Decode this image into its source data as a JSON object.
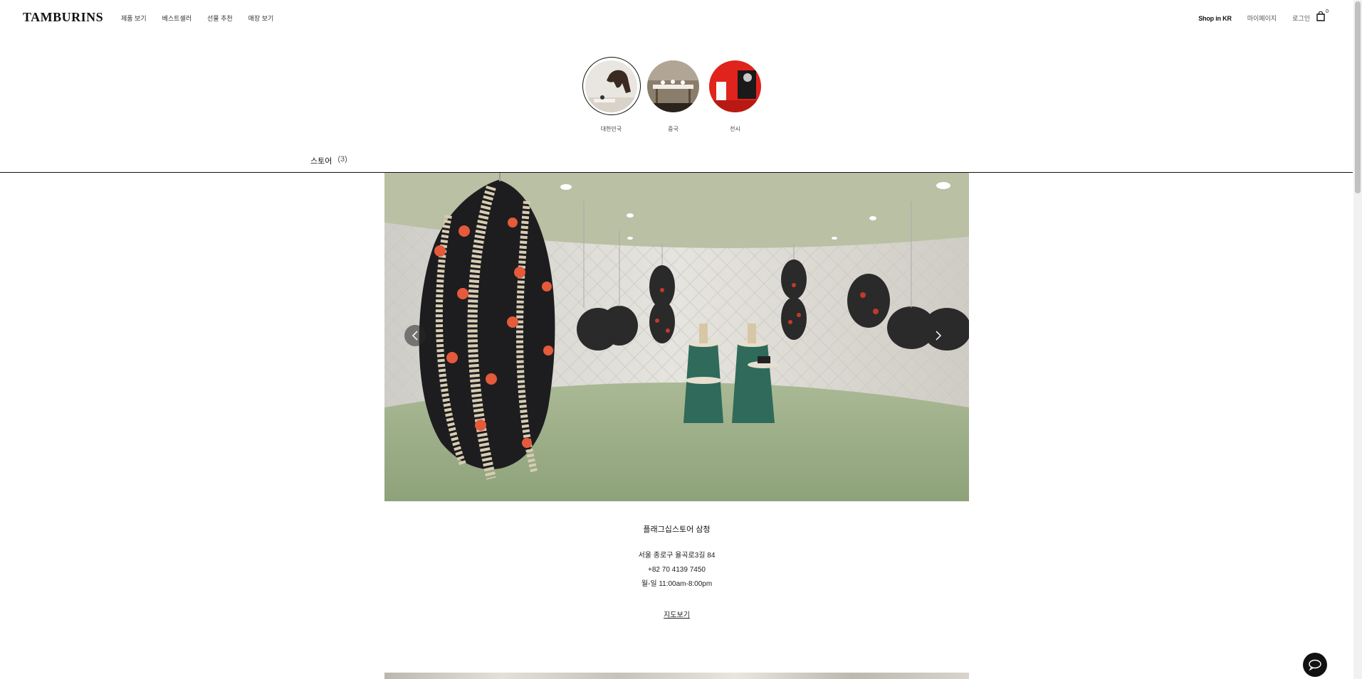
{
  "header": {
    "logo": "TAMBURINS",
    "nav": [
      {
        "label": "제품 보기"
      },
      {
        "label": "베스트셀러"
      },
      {
        "label": "선물 추천"
      },
      {
        "label": "매장 보기"
      }
    ],
    "util": {
      "shop": "Shop in KR",
      "mypage": "마이페이지",
      "login": "로그인",
      "cart_count": "0"
    }
  },
  "regions": [
    {
      "label": "대한민국",
      "active": true,
      "icon": "store-horse-image"
    },
    {
      "label": "중국",
      "active": false,
      "icon": "store-table-image"
    },
    {
      "label": "전시",
      "active": false,
      "icon": "exhibition-red-image"
    }
  ],
  "tab": {
    "label": "스토어",
    "count": "(3)"
  },
  "slider": {
    "prev_icon": "chevron-left-icon",
    "next_icon": "chevron-right-icon"
  },
  "store": {
    "name": "플래그십스토어 삼청",
    "address": "서울 종로구 율곡로3길 84",
    "phone": "+82 70 4139 7450",
    "hours": "월-일 11:00am-8:00pm",
    "map_label": "지도보기"
  },
  "colors": {
    "accent": "#111111",
    "floor": "#9aae84",
    "pedestal": "#2f6a5a"
  }
}
